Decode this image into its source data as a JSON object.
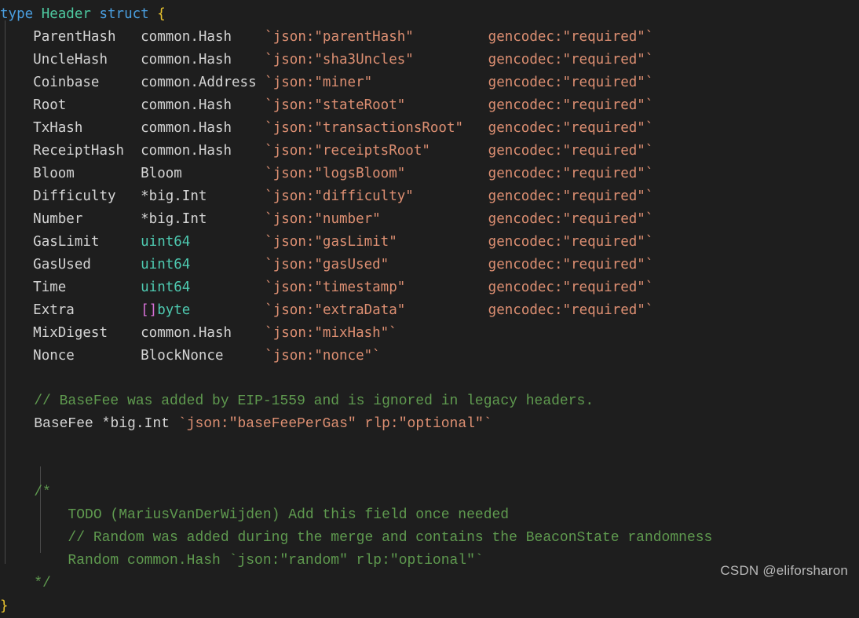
{
  "editor": {
    "background": "#1e1e1e",
    "watermark": "CSDN @eliforsharon",
    "language": "go",
    "colors": {
      "keyword": "#4a9fe0",
      "type_name": "#4ec9a0",
      "brace": "#e8c22e",
      "identifier": "#d4d4d4",
      "builtin_type": "#4ec9b0",
      "punctuation": "#d670d6",
      "struct_tag": "#dd8f72",
      "comment": "#5f9a4f",
      "watermark": "#b9b9b9",
      "indent_guide": "#4a4a4a"
    }
  },
  "code": {
    "declaration": {
      "keyword_type": "type",
      "name": "Header",
      "keyword_struct": "struct",
      "open_brace": "{",
      "close_brace": "}"
    },
    "fields": [
      {
        "name": "ParentHash",
        "type": "common.Hash",
        "type_kind": "plain",
        "tag_open": "`",
        "tag_json": "json:\"parentHash\"",
        "tag_extra": "gencodec:\"required\"",
        "tag_close": "`"
      },
      {
        "name": "UncleHash",
        "type": "common.Hash",
        "type_kind": "plain",
        "tag_open": "`",
        "tag_json": "json:\"sha3Uncles\"",
        "tag_extra": "gencodec:\"required\"",
        "tag_close": "`"
      },
      {
        "name": "Coinbase",
        "type": "common.Address",
        "type_kind": "plain",
        "tag_open": "`",
        "tag_json": "json:\"miner\"",
        "tag_extra": "gencodec:\"required\"",
        "tag_close": "`"
      },
      {
        "name": "Root",
        "type": "common.Hash",
        "type_kind": "plain",
        "tag_open": "`",
        "tag_json": "json:\"stateRoot\"",
        "tag_extra": "gencodec:\"required\"",
        "tag_close": "`"
      },
      {
        "name": "TxHash",
        "type": "common.Hash",
        "type_kind": "plain",
        "tag_open": "`",
        "tag_json": "json:\"transactionsRoot\"",
        "tag_extra": "gencodec:\"required\"",
        "tag_close": "`"
      },
      {
        "name": "ReceiptHash",
        "type": "common.Hash",
        "type_kind": "plain",
        "tag_open": "`",
        "tag_json": "json:\"receiptsRoot\"",
        "tag_extra": "gencodec:\"required\"",
        "tag_close": "`"
      },
      {
        "name": "Bloom",
        "type": "Bloom",
        "type_kind": "plain",
        "tag_open": "`",
        "tag_json": "json:\"logsBloom\"",
        "tag_extra": "gencodec:\"required\"",
        "tag_close": "`"
      },
      {
        "name": "Difficulty",
        "type": "*big.Int",
        "type_kind": "plain",
        "tag_open": "`",
        "tag_json": "json:\"difficulty\"",
        "tag_extra": "gencodec:\"required\"",
        "tag_close": "`"
      },
      {
        "name": "Number",
        "type": "*big.Int",
        "type_kind": "plain",
        "tag_open": "`",
        "tag_json": "json:\"number\"",
        "tag_extra": "gencodec:\"required\"",
        "tag_close": "`"
      },
      {
        "name": "GasLimit",
        "type": "uint64",
        "type_kind": "builtin",
        "tag_open": "`",
        "tag_json": "json:\"gasLimit\"",
        "tag_extra": "gencodec:\"required\"",
        "tag_close": "`"
      },
      {
        "name": "GasUsed",
        "type": "uint64",
        "type_kind": "builtin",
        "tag_open": "`",
        "tag_json": "json:\"gasUsed\"",
        "tag_extra": "gencodec:\"required\"",
        "tag_close": "`"
      },
      {
        "name": "Time",
        "type": "uint64",
        "type_kind": "builtin",
        "tag_open": "`",
        "tag_json": "json:\"timestamp\"",
        "tag_extra": "gencodec:\"required\"",
        "tag_close": "`"
      },
      {
        "name": "Extra",
        "type": "[]byte",
        "type_kind": "slice",
        "type_prefix": "[]",
        "type_base": "byte",
        "tag_open": "`",
        "tag_json": "json:\"extraData\"",
        "tag_extra": "gencodec:\"required\"",
        "tag_close": "`"
      },
      {
        "name": "MixDigest",
        "type": "common.Hash",
        "type_kind": "plain",
        "tag_open": "`",
        "tag_json": "json:\"mixHash\"",
        "tag_extra": "",
        "tag_close": "`"
      },
      {
        "name": "Nonce",
        "type": "BlockNonce",
        "type_kind": "plain",
        "tag_open": "`",
        "tag_json": "json:\"nonce\"",
        "tag_extra": "",
        "tag_close": "`"
      }
    ],
    "basefee_comment": "// BaseFee was added by EIP-1559 and is ignored in legacy headers.",
    "basefee_field": {
      "name": "BaseFee",
      "type": "*big.Int",
      "tag": "`json:\"baseFeePerGas\" rlp:\"optional\"`"
    },
    "block_comment": {
      "open": "/*",
      "lines": [
        "TODO (MariusVanDerWijden) Add this field once needed",
        "// Random was added during the merge and contains the BeaconState randomness",
        "Random common.Hash `json:\"random\" rlp:\"optional\"`"
      ],
      "close": "*/"
    }
  }
}
